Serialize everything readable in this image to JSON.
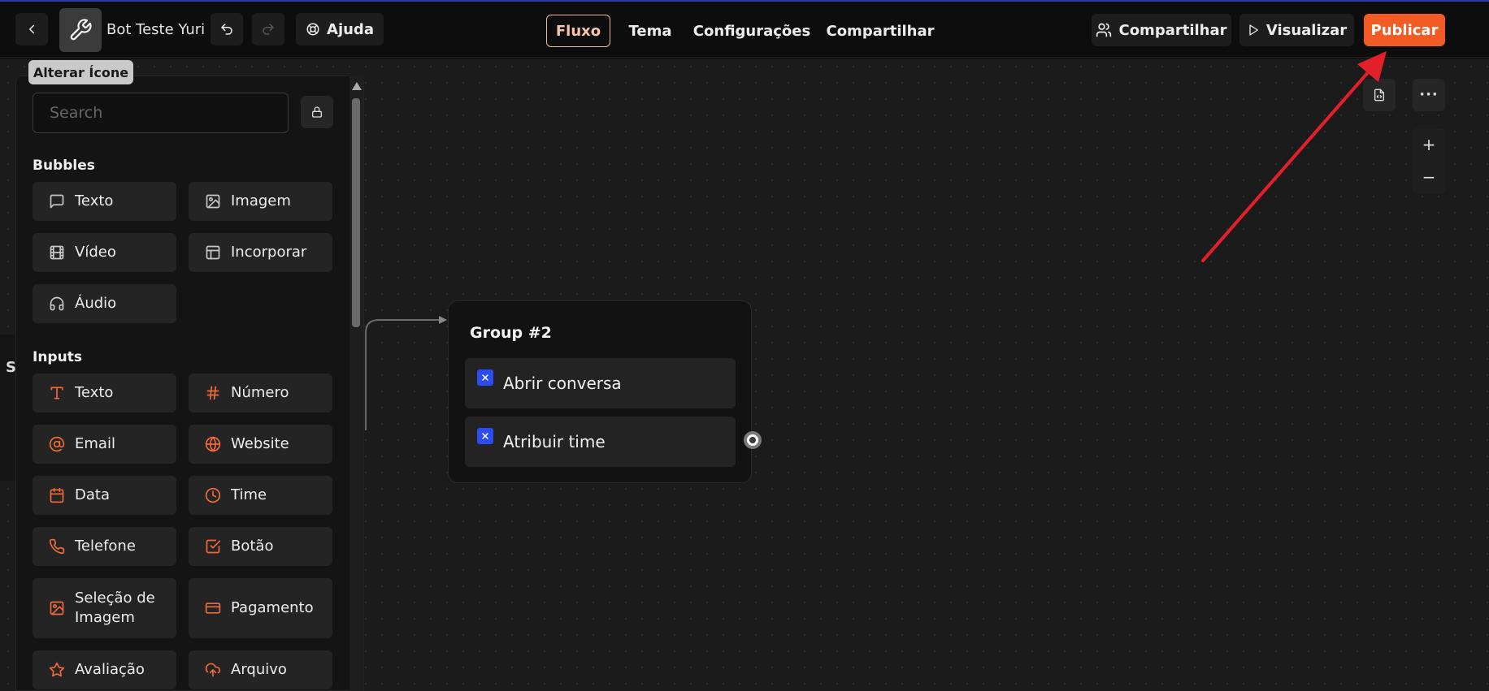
{
  "header": {
    "bot_name": "Bot Teste Yuri",
    "help_label": "Ajuda",
    "tabs": [
      {
        "label": "Fluxo",
        "active": true
      },
      {
        "label": "Tema",
        "active": false
      },
      {
        "label": "Configurações",
        "active": false
      },
      {
        "label": "Compartilhar",
        "active": false
      }
    ],
    "share_label": "Compartilhar",
    "preview_label": "Visualizar",
    "publish_label": "Publicar"
  },
  "tooltip": {
    "text": "Alterar Ícone"
  },
  "sidebar": {
    "search_placeholder": "Search",
    "bubbles_title": "Bubbles",
    "bubbles": [
      {
        "label": "Texto",
        "icon": "message-icon"
      },
      {
        "label": "Imagem",
        "icon": "image-icon"
      },
      {
        "label": "Vídeo",
        "icon": "film-icon"
      },
      {
        "label": "Incorporar",
        "icon": "layout-icon"
      },
      {
        "label": "Áudio",
        "icon": "headphones-icon"
      }
    ],
    "inputs_title": "Inputs",
    "inputs": [
      {
        "label": "Texto",
        "icon": "text-icon"
      },
      {
        "label": "Número",
        "icon": "hash-icon"
      },
      {
        "label": "Email",
        "icon": "at-icon"
      },
      {
        "label": "Website",
        "icon": "globe-icon"
      },
      {
        "label": "Data",
        "icon": "calendar-icon"
      },
      {
        "label": "Time",
        "icon": "clock-icon"
      },
      {
        "label": "Telefone",
        "icon": "phone-icon"
      },
      {
        "label": "Botão",
        "icon": "checkbox-icon"
      },
      {
        "label": "Seleção de Imagem",
        "icon": "image-select-icon"
      },
      {
        "label": "Pagamento",
        "icon": "credit-card-icon"
      },
      {
        "label": "Avaliação",
        "icon": "star-icon"
      },
      {
        "label": "Arquivo",
        "icon": "upload-icon"
      }
    ]
  },
  "canvas": {
    "hidden_panel_letter": "S",
    "group": {
      "title": "Group #2",
      "blocks": [
        {
          "label": "Abrir conversa"
        },
        {
          "label": "Atribuir time"
        }
      ]
    }
  },
  "colors": {
    "accent": "#f35b24",
    "integration_block": "#2a4cf0",
    "annotation_arrow": "#e3202a"
  }
}
